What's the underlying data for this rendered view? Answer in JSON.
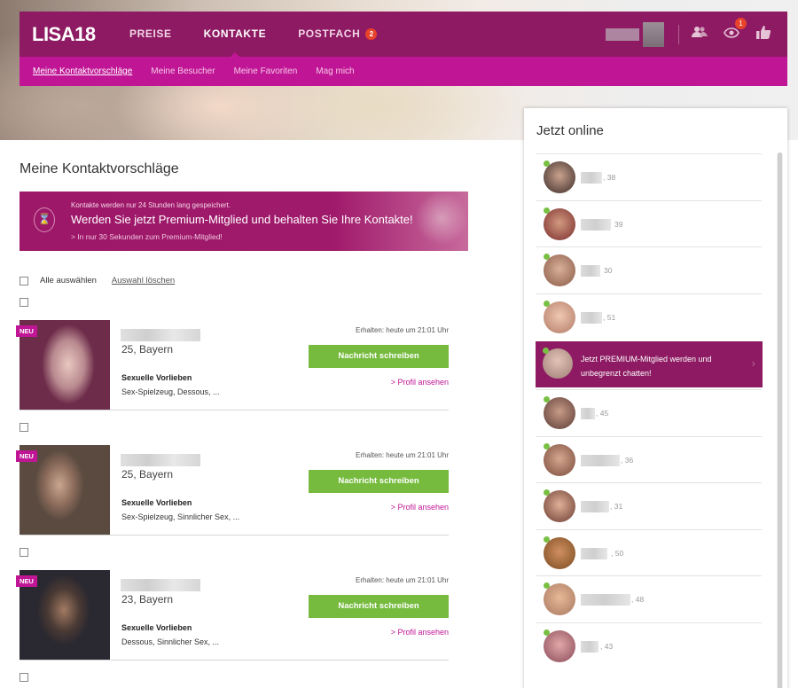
{
  "brand": "LISA18",
  "nav": {
    "items": [
      {
        "label": "PREISE",
        "active": false
      },
      {
        "label": "KONTAKTE",
        "active": true
      },
      {
        "label": "POSTFACH",
        "active": false,
        "badge": "2"
      }
    ],
    "icons": {
      "contacts": "users-icon",
      "visitors": "eye-icon",
      "visitors_badge": "1",
      "likes": "thumbs-up-icon"
    }
  },
  "subnav": {
    "items": [
      {
        "label": "Meine Kontaktvorschläge",
        "active": true
      },
      {
        "label": "Meine Besucher",
        "active": false
      },
      {
        "label": "Meine Favoriten",
        "active": false
      },
      {
        "label": "Mag mich",
        "active": false
      }
    ]
  },
  "main": {
    "title": "Meine Kontaktvorschläge",
    "promo": {
      "small": "Kontakte werden nur 24 Stunden lang gespeichert.",
      "big": "Werden Sie jetzt Premium-Mitglied und behalten Sie Ihre Kontakte!",
      "link": "> In nur 30 Sekunden zum Premium-Mitglied!"
    },
    "select_all": "Alle auswählen",
    "clear_selection": "Auswahl löschen",
    "cards": [
      {
        "badge": "NEU",
        "age_region": "25, Bayern",
        "prefs_heading": "Sexuelle Vorlieben",
        "prefs": "Sex-Spielzeug, Dessous, ...",
        "received": "Erhalten: heute um 21:01 Uhr",
        "message": "Nachricht schreiben",
        "profile": "Profil ansehen"
      },
      {
        "badge": "NEU",
        "age_region": "25, Bayern",
        "prefs_heading": "Sexuelle Vorlieben",
        "prefs": "Sex-Spielzeug, Sinnlicher Sex, ...",
        "received": "Erhalten: heute um 21:01 Uhr",
        "message": "Nachricht schreiben",
        "profile": "Profil ansehen"
      },
      {
        "badge": "NEU",
        "age_region": "23, Bayern",
        "prefs_heading": "Sexuelle Vorlieben",
        "prefs": "Dessous, Sinnlicher Sex, ...",
        "received": "Erhalten: heute um 21:01 Uhr",
        "message": "Nachricht schreiben",
        "profile": "Profil ansehen"
      }
    ]
  },
  "online": {
    "title": "Jetzt online",
    "users_top": [
      {
        "age": ", 38"
      },
      {
        "age": "39"
      },
      {
        "age": "30"
      },
      {
        "age": ", 51"
      }
    ],
    "premium": "Jetzt PREMIUM-Mitglied werden und unbegrenzt chatten!",
    "users_bottom": [
      {
        "age": ", 45"
      },
      {
        "age": ", 36"
      },
      {
        "age": ", 31"
      },
      {
        "age": ", 50"
      },
      {
        "age": ", 48"
      },
      {
        "age": ", 43"
      }
    ]
  },
  "colors": {
    "brand_dark": "#8d1a62",
    "brand_pink": "#c01696",
    "button_green": "#76bb3e",
    "online_dot": "#78c043"
  }
}
